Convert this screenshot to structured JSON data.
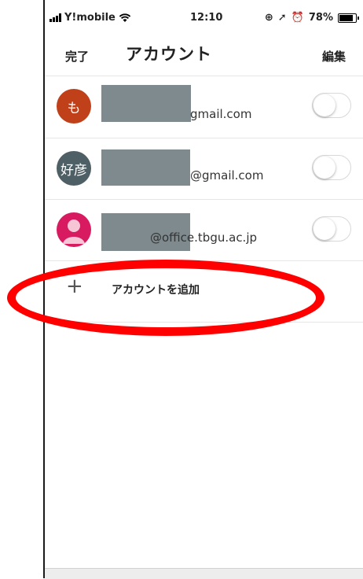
{
  "status_bar": {
    "carrier": "Y!mobile",
    "time": "12:10",
    "battery": "78%"
  },
  "nav": {
    "done_label": "完了",
    "title": "アカウント",
    "edit_label": "編集"
  },
  "accounts": [
    {
      "avatar_text": "も",
      "avatar_color": "#c0401a",
      "email_suffix": "gmail.com",
      "enabled": false
    },
    {
      "avatar_text": "好彦",
      "avatar_color": "#4f5f66",
      "email_suffix": "@gmail.com",
      "enabled": false
    },
    {
      "avatar_text": "",
      "avatar_color": "#d81b60",
      "avatar_icon": "person-icon",
      "email_suffix": "@office.tbgu.ac.jp",
      "enabled": false
    }
  ],
  "add_account": {
    "plus": "+",
    "label": "アカウントを追加"
  },
  "annotation": {
    "color": "#ff0000"
  }
}
